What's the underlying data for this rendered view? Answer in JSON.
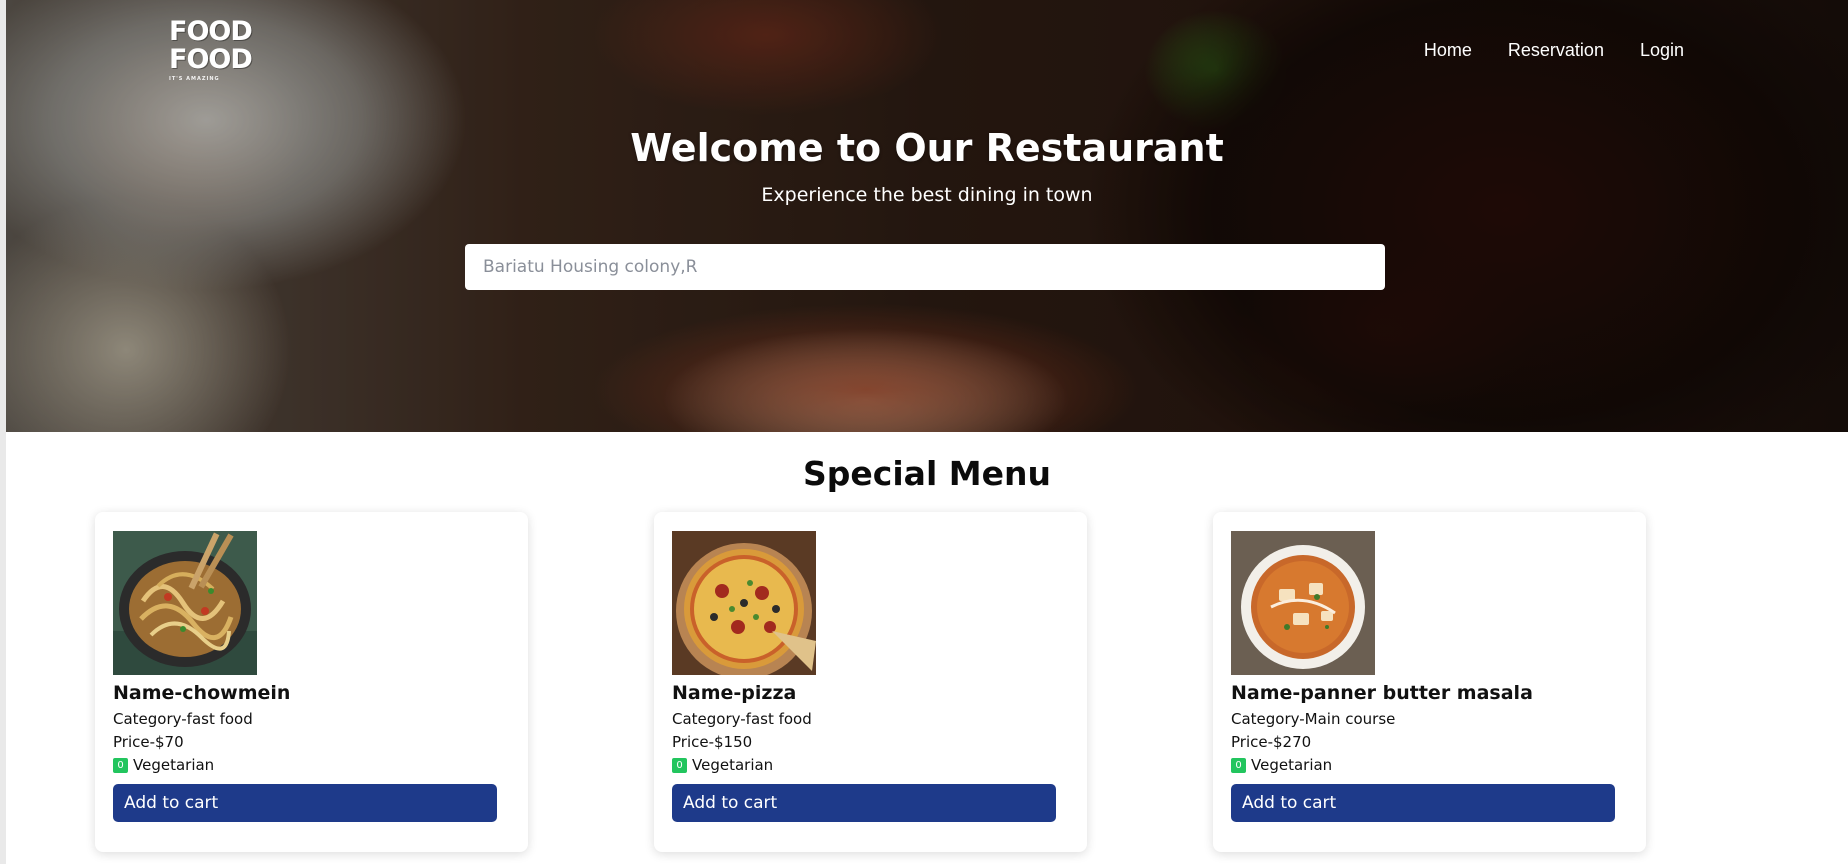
{
  "brand": {
    "logo_line1": "FOOD",
    "logo_line2": "FOOD",
    "logo_tagline": "IT'S AMAZING"
  },
  "nav": {
    "items": [
      {
        "label": "Home"
      },
      {
        "label": "Reservation"
      },
      {
        "label": "Login"
      }
    ]
  },
  "hero": {
    "title": "Welcome to Our Restaurant",
    "subtitle": "Experience the best dining in town"
  },
  "search": {
    "value": "",
    "placeholder": "Bariatu Housing colony,R"
  },
  "special_menu": {
    "title": "Special Menu",
    "items": [
      {
        "name": "Name-chowmein",
        "category": "Category-fast food",
        "price": "Price-$70",
        "veg_badge": "0",
        "diet": "Vegetarian",
        "button_label": "Add to cart",
        "image_icon": "chowmein-photo"
      },
      {
        "name": "Name-pizza",
        "category": "Category-fast food",
        "price": "Price-$150",
        "veg_badge": "0",
        "diet": "Vegetarian",
        "button_label": "Add to cart",
        "image_icon": "pizza-photo"
      },
      {
        "name": "Name-panner butter masala",
        "category": "Category-Main course",
        "price": "Price-$270",
        "veg_badge": "0",
        "diet": "Vegetarian",
        "button_label": "Add to cart",
        "image_icon": "curry-photo"
      }
    ]
  },
  "colors": {
    "primary_button": "#1e3a8a",
    "veg_badge": "#22c55e",
    "background": "#ffffff"
  }
}
